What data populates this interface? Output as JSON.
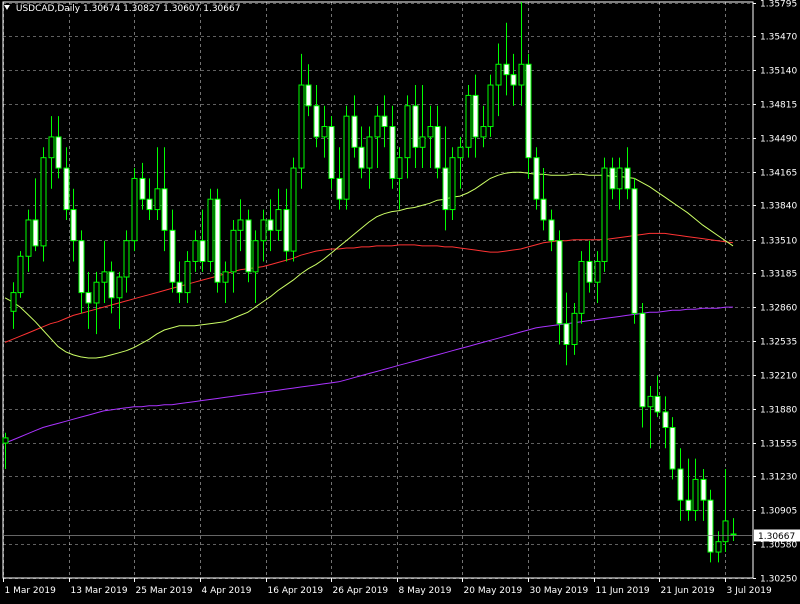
{
  "header": {
    "symbol": "USDCAD,Daily",
    "ohlc": "1.30674 1.30827 1.30607 1.30667"
  },
  "colors": {
    "background": "#000000",
    "grid": "#ffffff",
    "candle": "#00ff00",
    "bull_body": "#000000",
    "bear_body": "#ffffff",
    "ma_fast": "#ccff66",
    "ma_mid": "#ff3333",
    "ma_slow": "#aa33ff",
    "price_label_bg": "#ffffff",
    "price_label_fg": "#000000"
  },
  "chart_data": {
    "type": "candlestick",
    "instrument": "USDCAD",
    "timeframe": "Daily",
    "ylim": [
      1.3025,
      1.358
    ],
    "grid": true,
    "y_ticks": [
      "1.35795",
      "1.35470",
      "1.35140",
      "1.34815",
      "1.34490",
      "1.34165",
      "1.33840",
      "1.33510",
      "1.33185",
      "1.32860",
      "1.32535",
      "1.32210",
      "1.31880",
      "1.31555",
      "1.31230",
      "1.30905",
      "1.30580",
      "1.30250"
    ],
    "x_ticks": [
      "1 Mar 2019",
      "13 Mar 2019",
      "25 Mar 2019",
      "4 Apr 2019",
      "16 Apr 2019",
      "26 Apr 2019",
      "8 May 2019",
      "20 May 2019",
      "30 May 2019",
      "11 Jun 2019",
      "21 Jun 2019",
      "3 Jul 2019"
    ],
    "current_price": "1.30667",
    "candles": [
      {
        "o": 1.3155,
        "h": 1.3165,
        "l": 1.313,
        "c": 1.316
      },
      {
        "o": 1.3282,
        "h": 1.331,
        "l": 1.3265,
        "c": 1.33
      },
      {
        "o": 1.33,
        "h": 1.334,
        "l": 1.3295,
        "c": 1.3335
      },
      {
        "o": 1.3335,
        "h": 1.338,
        "l": 1.332,
        "c": 1.337
      },
      {
        "o": 1.337,
        "h": 1.341,
        "l": 1.334,
        "c": 1.3345
      },
      {
        "o": 1.3345,
        "h": 1.344,
        "l": 1.333,
        "c": 1.343
      },
      {
        "o": 1.343,
        "h": 1.347,
        "l": 1.34,
        "c": 1.345
      },
      {
        "o": 1.345,
        "h": 1.347,
        "l": 1.341,
        "c": 1.342
      },
      {
        "o": 1.342,
        "h": 1.344,
        "l": 1.337,
        "c": 1.338
      },
      {
        "o": 1.338,
        "h": 1.34,
        "l": 1.333,
        "c": 1.335
      },
      {
        "o": 1.335,
        "h": 1.336,
        "l": 1.328,
        "c": 1.33
      },
      {
        "o": 1.33,
        "h": 1.332,
        "l": 1.3265,
        "c": 1.329
      },
      {
        "o": 1.329,
        "h": 1.332,
        "l": 1.326,
        "c": 1.331
      },
      {
        "o": 1.331,
        "h": 1.335,
        "l": 1.329,
        "c": 1.332
      },
      {
        "o": 1.332,
        "h": 1.333,
        "l": 1.328,
        "c": 1.3295
      },
      {
        "o": 1.3295,
        "h": 1.332,
        "l": 1.3265,
        "c": 1.3315
      },
      {
        "o": 1.3315,
        "h": 1.336,
        "l": 1.33,
        "c": 1.335
      },
      {
        "o": 1.335,
        "h": 1.342,
        "l": 1.334,
        "c": 1.341
      },
      {
        "o": 1.341,
        "h": 1.3425,
        "l": 1.338,
        "c": 1.339
      },
      {
        "o": 1.339,
        "h": 1.341,
        "l": 1.337,
        "c": 1.338
      },
      {
        "o": 1.338,
        "h": 1.344,
        "l": 1.337,
        "c": 1.34
      },
      {
        "o": 1.34,
        "h": 1.344,
        "l": 1.334,
        "c": 1.336
      },
      {
        "o": 1.336,
        "h": 1.338,
        "l": 1.33,
        "c": 1.331
      },
      {
        "o": 1.331,
        "h": 1.333,
        "l": 1.329,
        "c": 1.33
      },
      {
        "o": 1.33,
        "h": 1.334,
        "l": 1.329,
        "c": 1.333
      },
      {
        "o": 1.333,
        "h": 1.336,
        "l": 1.332,
        "c": 1.335
      },
      {
        "o": 1.335,
        "h": 1.338,
        "l": 1.332,
        "c": 1.333
      },
      {
        "o": 1.333,
        "h": 1.34,
        "l": 1.332,
        "c": 1.339
      },
      {
        "o": 1.339,
        "h": 1.34,
        "l": 1.33,
        "c": 1.331
      },
      {
        "o": 1.331,
        "h": 1.333,
        "l": 1.329,
        "c": 1.332
      },
      {
        "o": 1.332,
        "h": 1.337,
        "l": 1.33,
        "c": 1.336
      },
      {
        "o": 1.336,
        "h": 1.339,
        "l": 1.334,
        "c": 1.337
      },
      {
        "o": 1.337,
        "h": 1.338,
        "l": 1.331,
        "c": 1.332
      },
      {
        "o": 1.332,
        "h": 1.336,
        "l": 1.329,
        "c": 1.335
      },
      {
        "o": 1.335,
        "h": 1.338,
        "l": 1.333,
        "c": 1.337
      },
      {
        "o": 1.337,
        "h": 1.339,
        "l": 1.334,
        "c": 1.336
      },
      {
        "o": 1.336,
        "h": 1.34,
        "l": 1.335,
        "c": 1.338
      },
      {
        "o": 1.338,
        "h": 1.34,
        "l": 1.333,
        "c": 1.334
      },
      {
        "o": 1.334,
        "h": 1.343,
        "l": 1.333,
        "c": 1.342
      },
      {
        "o": 1.342,
        "h": 1.353,
        "l": 1.34,
        "c": 1.35
      },
      {
        "o": 1.35,
        "h": 1.352,
        "l": 1.347,
        "c": 1.348
      },
      {
        "o": 1.348,
        "h": 1.35,
        "l": 1.344,
        "c": 1.345
      },
      {
        "o": 1.345,
        "h": 1.348,
        "l": 1.343,
        "c": 1.346
      },
      {
        "o": 1.346,
        "h": 1.347,
        "l": 1.34,
        "c": 1.341
      },
      {
        "o": 1.341,
        "h": 1.344,
        "l": 1.338,
        "c": 1.339
      },
      {
        "o": 1.339,
        "h": 1.348,
        "l": 1.338,
        "c": 1.347
      },
      {
        "o": 1.347,
        "h": 1.349,
        "l": 1.343,
        "c": 1.344
      },
      {
        "o": 1.344,
        "h": 1.346,
        "l": 1.341,
        "c": 1.342
      },
      {
        "o": 1.342,
        "h": 1.346,
        "l": 1.34,
        "c": 1.345
      },
      {
        "o": 1.345,
        "h": 1.348,
        "l": 1.342,
        "c": 1.347
      },
      {
        "o": 1.347,
        "h": 1.349,
        "l": 1.344,
        "c": 1.346
      },
      {
        "o": 1.346,
        "h": 1.348,
        "l": 1.34,
        "c": 1.341
      },
      {
        "o": 1.341,
        "h": 1.344,
        "l": 1.338,
        "c": 1.343
      },
      {
        "o": 1.343,
        "h": 1.349,
        "l": 1.341,
        "c": 1.348
      },
      {
        "o": 1.348,
        "h": 1.35,
        "l": 1.342,
        "c": 1.344
      },
      {
        "o": 1.344,
        "h": 1.35,
        "l": 1.342,
        "c": 1.345
      },
      {
        "o": 1.345,
        "h": 1.348,
        "l": 1.342,
        "c": 1.346
      },
      {
        "o": 1.346,
        "h": 1.348,
        "l": 1.341,
        "c": 1.342
      },
      {
        "o": 1.342,
        "h": 1.346,
        "l": 1.336,
        "c": 1.338
      },
      {
        "o": 1.338,
        "h": 1.344,
        "l": 1.337,
        "c": 1.343
      },
      {
        "o": 1.343,
        "h": 1.345,
        "l": 1.34,
        "c": 1.344
      },
      {
        "o": 1.344,
        "h": 1.35,
        "l": 1.343,
        "c": 1.349
      },
      {
        "o": 1.349,
        "h": 1.351,
        "l": 1.343,
        "c": 1.345
      },
      {
        "o": 1.345,
        "h": 1.348,
        "l": 1.344,
        "c": 1.346
      },
      {
        "o": 1.346,
        "h": 1.351,
        "l": 1.345,
        "c": 1.35
      },
      {
        "o": 1.35,
        "h": 1.354,
        "l": 1.347,
        "c": 1.352
      },
      {
        "o": 1.352,
        "h": 1.356,
        "l": 1.349,
        "c": 1.351
      },
      {
        "o": 1.351,
        "h": 1.353,
        "l": 1.348,
        "c": 1.35
      },
      {
        "o": 1.35,
        "h": 1.358,
        "l": 1.348,
        "c": 1.352
      },
      {
        "o": 1.352,
        "h": 1.353,
        "l": 1.341,
        "c": 1.343
      },
      {
        "o": 1.343,
        "h": 1.344,
        "l": 1.338,
        "c": 1.339
      },
      {
        "o": 1.339,
        "h": 1.342,
        "l": 1.336,
        "c": 1.337
      },
      {
        "o": 1.337,
        "h": 1.338,
        "l": 1.334,
        "c": 1.335
      },
      {
        "o": 1.335,
        "h": 1.336,
        "l": 1.325,
        "c": 1.327
      },
      {
        "o": 1.327,
        "h": 1.33,
        "l": 1.323,
        "c": 1.325
      },
      {
        "o": 1.325,
        "h": 1.329,
        "l": 1.324,
        "c": 1.328
      },
      {
        "o": 1.328,
        "h": 1.334,
        "l": 1.327,
        "c": 1.333
      },
      {
        "o": 1.333,
        "h": 1.335,
        "l": 1.33,
        "c": 1.331
      },
      {
        "o": 1.331,
        "h": 1.334,
        "l": 1.329,
        "c": 1.333
      },
      {
        "o": 1.333,
        "h": 1.343,
        "l": 1.332,
        "c": 1.342
      },
      {
        "o": 1.342,
        "h": 1.343,
        "l": 1.339,
        "c": 1.34
      },
      {
        "o": 1.34,
        "h": 1.343,
        "l": 1.338,
        "c": 1.342
      },
      {
        "o": 1.342,
        "h": 1.344,
        "l": 1.339,
        "c": 1.34
      },
      {
        "o": 1.34,
        "h": 1.341,
        "l": 1.327,
        "c": 1.328
      },
      {
        "o": 1.328,
        "h": 1.329,
        "l": 1.317,
        "c": 1.319
      },
      {
        "o": 1.319,
        "h": 1.321,
        "l": 1.315,
        "c": 1.32
      },
      {
        "o": 1.32,
        "h": 1.322,
        "l": 1.318,
        "c": 1.3185
      },
      {
        "o": 1.3185,
        "h": 1.32,
        "l": 1.315,
        "c": 1.317
      },
      {
        "o": 1.317,
        "h": 1.318,
        "l": 1.312,
        "c": 1.313
      },
      {
        "o": 1.313,
        "h": 1.315,
        "l": 1.308,
        "c": 1.31
      },
      {
        "o": 1.31,
        "h": 1.314,
        "l": 1.308,
        "c": 1.309
      },
      {
        "o": 1.309,
        "h": 1.314,
        "l": 1.308,
        "c": 1.312
      },
      {
        "o": 1.312,
        "h": 1.313,
        "l": 1.308,
        "c": 1.31
      },
      {
        "o": 1.31,
        "h": 1.311,
        "l": 1.304,
        "c": 1.305
      },
      {
        "o": 1.305,
        "h": 1.307,
        "l": 1.304,
        "c": 1.306
      },
      {
        "o": 1.306,
        "h": 1.313,
        "l": 1.305,
        "c": 1.308
      },
      {
        "o": 1.30674,
        "h": 1.30827,
        "l": 1.30607,
        "c": 1.30667
      }
    ],
    "ma_fast": [
      1.3295,
      1.3291,
      1.3286,
      1.3279,
      1.3272,
      1.3264,
      1.3256,
      1.3248,
      1.3243,
      1.324,
      1.3238,
      1.3237,
      1.3237,
      1.3238,
      1.324,
      1.3242,
      1.3244,
      1.3247,
      1.3251,
      1.3255,
      1.326,
      1.3264,
      1.3266,
      1.3268,
      1.3268,
      1.3268,
      1.3269,
      1.327,
      1.3271,
      1.3272,
      1.3275,
      1.3278,
      1.3281,
      1.3286,
      1.3291,
      1.3296,
      1.3302,
      1.3307,
      1.3312,
      1.3318,
      1.3323,
      1.3327,
      1.3332,
      1.3338,
      1.3344,
      1.335,
      1.3356,
      1.3362,
      1.3368,
      1.3373,
      1.3376,
      1.3378,
      1.3379,
      1.3381,
      1.3382,
      1.3384,
      1.3386,
      1.3389,
      1.339,
      1.3392,
      1.3393,
      1.3396,
      1.34,
      1.3405,
      1.341,
      1.3413,
      1.3415,
      1.3416,
      1.3416,
      1.3415,
      1.3414,
      1.3414,
      1.3413,
      1.3413,
      1.3413,
      1.3414,
      1.3414,
      1.3413,
      1.3413,
      1.3413,
      1.3412,
      1.3412,
      1.3411,
      1.341,
      1.3406,
      1.3402,
      1.3397,
      1.3392,
      1.3387,
      1.3382,
      1.3377,
      1.3371,
      1.3365,
      1.336,
      1.3355,
      1.335,
      1.3345
    ],
    "ma_mid": [
      1.3252,
      1.3255,
      1.3258,
      1.3261,
      1.3264,
      1.3267,
      1.327,
      1.3272,
      1.3275,
      1.3278,
      1.328,
      1.3282,
      1.3284,
      1.3286,
      1.3288,
      1.329,
      1.3292,
      1.3294,
      1.3296,
      1.3298,
      1.33,
      1.3302,
      1.3304,
      1.3306,
      1.3308,
      1.331,
      1.3312,
      1.3314,
      1.3316,
      1.3318,
      1.332,
      1.3322,
      1.3323,
      1.3324,
      1.3325,
      1.3327,
      1.3329,
      1.3331,
      1.3333,
      1.3336,
      1.3338,
      1.334,
      1.3341,
      1.3342,
      1.3342,
      1.3343,
      1.3343,
      1.3344,
      1.3344,
      1.3345,
      1.3345,
      1.3345,
      1.3346,
      1.3346,
      1.3346,
      1.3345,
      1.3345,
      1.3345,
      1.3344,
      1.3344,
      1.3343,
      1.3342,
      1.3341,
      1.334,
      1.3339,
      1.3339,
      1.334,
      1.3341,
      1.3342,
      1.3344,
      1.3346,
      1.3348,
      1.3349,
      1.335,
      1.335,
      1.3351,
      1.3351,
      1.3351,
      1.3351,
      1.3351,
      1.3352,
      1.3353,
      1.3354,
      1.3355,
      1.3356,
      1.3357,
      1.3357,
      1.3357,
      1.3356,
      1.3355,
      1.3354,
      1.3353,
      1.3352,
      1.3351,
      1.335,
      1.3349,
      1.3348
    ],
    "ma_slow": [
      1.3155,
      1.3158,
      1.3161,
      1.3164,
      1.3167,
      1.317,
      1.3172,
      1.3174,
      1.3176,
      1.3178,
      1.318,
      1.3182,
      1.3184,
      1.3186,
      1.3187,
      1.3188,
      1.3189,
      1.319,
      1.319,
      1.3191,
      1.3191,
      1.3192,
      1.3192,
      1.3193,
      1.3194,
      1.3195,
      1.3196,
      1.3197,
      1.3198,
      1.3199,
      1.32,
      1.3201,
      1.3202,
      1.3203,
      1.3204,
      1.3205,
      1.3206,
      1.3207,
      1.3208,
      1.3209,
      1.321,
      1.3211,
      1.3212,
      1.3213,
      1.3214,
      1.3216,
      1.3218,
      1.322,
      1.3222,
      1.3224,
      1.3226,
      1.3228,
      1.323,
      1.3232,
      1.3234,
      1.3236,
      1.3238,
      1.324,
      1.3242,
      1.3244,
      1.3246,
      1.3248,
      1.325,
      1.3252,
      1.3254,
      1.3256,
      1.3258,
      1.326,
      1.3262,
      1.3264,
      1.3266,
      1.3267,
      1.3268,
      1.3269,
      1.327,
      1.3271,
      1.3272,
      1.3273,
      1.3274,
      1.3275,
      1.3276,
      1.3277,
      1.3278,
      1.3279,
      1.328,
      1.3281,
      1.3281,
      1.3282,
      1.3283,
      1.3283,
      1.3284,
      1.3284,
      1.3285,
      1.3285,
      1.3285,
      1.3286,
      1.3286
    ]
  }
}
